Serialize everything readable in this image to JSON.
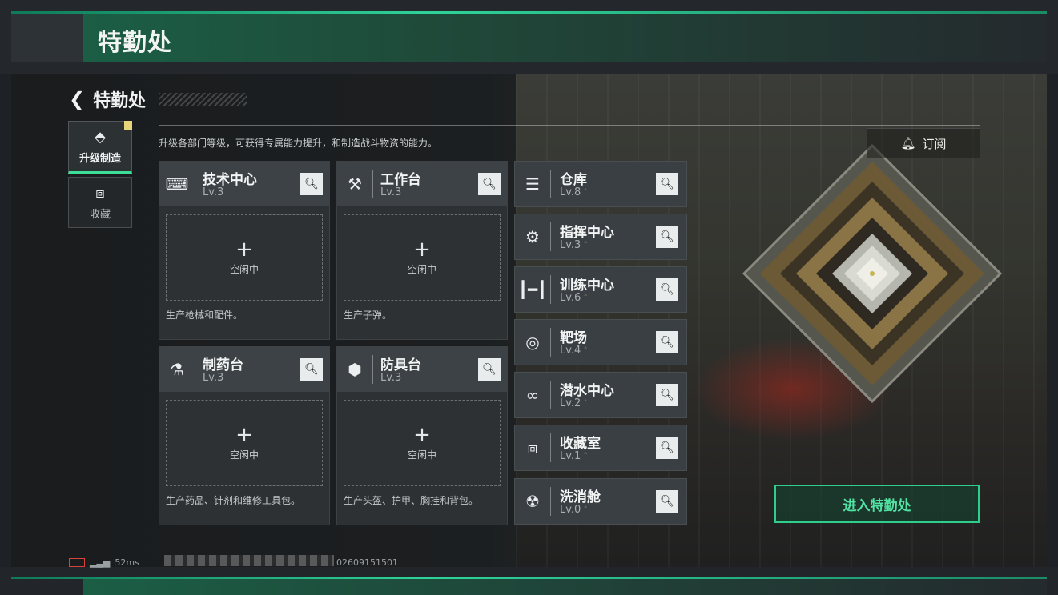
{
  "header": {
    "title": "特勤处"
  },
  "nav": {
    "back_label": "特勤处"
  },
  "description": "升级各部门等级，可获得专属能力提升，和制造战斗物资的能力。",
  "subscribe_label": "订阅",
  "side_tabs": [
    {
      "label": "升级制造",
      "icon": "upgrade-icon"
    },
    {
      "label": "收藏",
      "icon": "collection-icon"
    }
  ],
  "workshops": [
    {
      "name": "技术中心",
      "level": "Lv.3",
      "status": "空闲中",
      "desc": "生产枪械和配件。",
      "icon": "tech-center-icon"
    },
    {
      "name": "工作台",
      "level": "Lv.3",
      "status": "空闲中",
      "desc": "生产子弹。",
      "icon": "workbench-icon"
    },
    {
      "name": "制药台",
      "level": "Lv.3",
      "status": "空闲中",
      "desc": "生产药品、针剂和维修工具包。",
      "icon": "pharmacy-icon"
    },
    {
      "name": "防具台",
      "level": "Lv.3",
      "status": "空闲中",
      "desc": "生产头盔、护甲、胸挂和背包。",
      "icon": "armor-bench-icon"
    }
  ],
  "facilities": [
    {
      "name": "仓库",
      "level": "Lv.8",
      "icon": "warehouse-icon"
    },
    {
      "name": "指挥中心",
      "level": "Lv.3",
      "icon": "command-center-icon"
    },
    {
      "name": "训练中心",
      "level": "Lv.6",
      "icon": "training-icon"
    },
    {
      "name": "靶场",
      "level": "Lv.4",
      "icon": "target-icon"
    },
    {
      "name": "潜水中心",
      "level": "Lv.2",
      "icon": "diving-icon"
    },
    {
      "name": "收藏室",
      "level": "Lv.1",
      "icon": "collection-room-icon"
    },
    {
      "name": "洗消舱",
      "level": "Lv.0",
      "icon": "decon-icon"
    }
  ],
  "enter_button": "进入特勤处",
  "status": {
    "ping": "52ms",
    "uid_suffix": "02609151501"
  },
  "colors": {
    "accent": "#2ecf8c",
    "panel": "#3a3f43"
  }
}
